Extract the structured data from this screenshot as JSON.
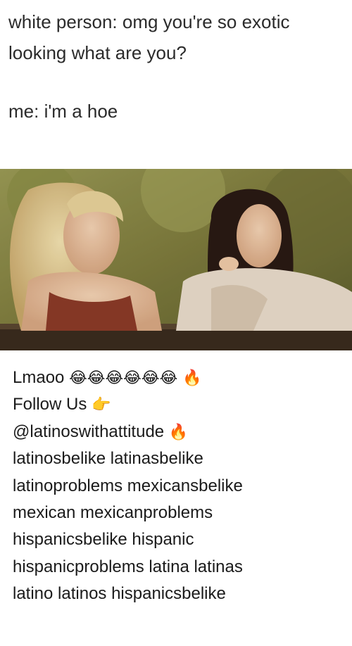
{
  "meme": {
    "line1": "white person: omg you're so exotic",
    "line2": "looking what are you?",
    "line3": "me: i'm a hoe"
  },
  "photo": {
    "icon": "film-still-two-women-image"
  },
  "caption": {
    "row1_text": "Lmaoo",
    "row1_emoji": "😂😂😂😂😂😂 🔥",
    "row2_text": "Follow Us",
    "row2_emoji": "👉",
    "row3_text": "@latinoswithattitude",
    "row3_emoji": "🔥",
    "row4": "latinosbelike latinasbelike",
    "row5": "latinoproblems mexicansbelike",
    "row6": "mexican mexicanproblems",
    "row7": "hispanicsbelike hispanic",
    "row8": "hispanicproblems latina latinas",
    "row9": "latino latinos hispanicsbelike"
  }
}
